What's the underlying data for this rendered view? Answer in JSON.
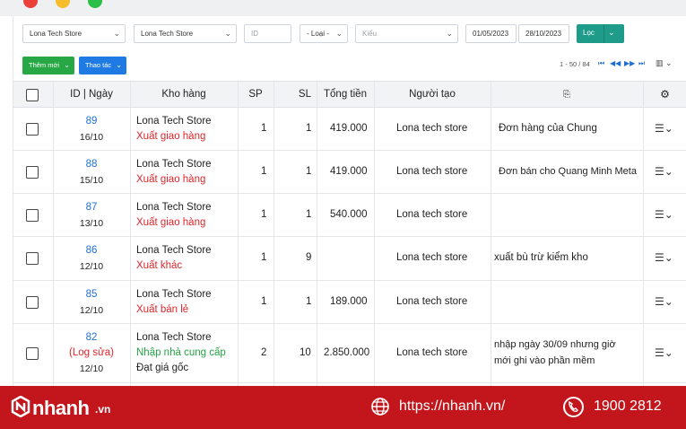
{
  "filters": {
    "store_1": "Lona Tech Store",
    "store_2": "Lona Tech Store",
    "id_placeholder": "ID",
    "type_select": "- Loại -",
    "kind_placeholder": "Kiểu",
    "date_from": "01/05/2023",
    "date_to": "28/10/2023",
    "filter_button": "Lọc"
  },
  "toolbar": {
    "add_new": "Thêm mới",
    "actions": "Thao tác",
    "pagination": "1 - 50 / 84"
  },
  "table": {
    "headers": {
      "id_date": "ID | Ngày",
      "warehouse": "Kho hàng",
      "products": "SP",
      "quantity": "SL",
      "total": "Tổng tiền",
      "creator": "Người tạo"
    },
    "rows": [
      {
        "id": "89",
        "date": "16/10",
        "store": "Lona Tech Store",
        "type": "Xuất giao hàng",
        "sp": "1",
        "sl": "1",
        "total": "419.000",
        "creator": "Lona tech store",
        "note": "Đơn hàng của Chung"
      },
      {
        "id": "88",
        "date": "15/10",
        "store": "Lona Tech Store",
        "type": "Xuất giao hàng",
        "sp": "1",
        "sl": "1",
        "total": "419.000",
        "creator": "Lona tech store",
        "note": "Đơn bán cho Quang Minh Meta"
      },
      {
        "id": "87",
        "date": "13/10",
        "store": "Lona Tech Store",
        "type": "Xuất giao hàng",
        "sp": "1",
        "sl": "1",
        "total": "540.000",
        "creator": "Lona tech store",
        "note": ""
      },
      {
        "id": "86",
        "date": "12/10",
        "store": "Lona Tech Store",
        "type": "Xuất khác",
        "sp": "1",
        "sl": "9",
        "total": "",
        "creator": "Lona tech store",
        "note": "xuất bù trừ kiểm kho"
      },
      {
        "id": "85",
        "date": "12/10",
        "store": "Lona Tech Store",
        "type": "Xuất bán lẻ",
        "sp": "1",
        "sl": "1",
        "total": "189.000",
        "creator": "Lona tech store",
        "note": ""
      },
      {
        "id": "82",
        "log": "(Log sửa)",
        "date": "12/10",
        "store": "Lona Tech Store",
        "type": "Nhập nhà cung cấp",
        "price_note": "Đạt giá gốc",
        "sp": "2",
        "sl": "10",
        "total": "2.850.000",
        "creator": "Lona tech store",
        "note_line1": "nhập ngày 30/09 nhưng giờ",
        "note_line2": "mới ghi vào phần mềm"
      }
    ]
  },
  "footer": {
    "brand": "nhanh",
    "brand_suffix": ".vn",
    "url": "https://nhanh.vn/",
    "phone": "1900 2812"
  },
  "colors": {
    "accent_teal": "#1e9c89",
    "add_green": "#28a745",
    "action_blue": "#1f7be3",
    "export_red": "#e0252a",
    "import_green": "#25a244",
    "footer_red": "#c3161c"
  }
}
